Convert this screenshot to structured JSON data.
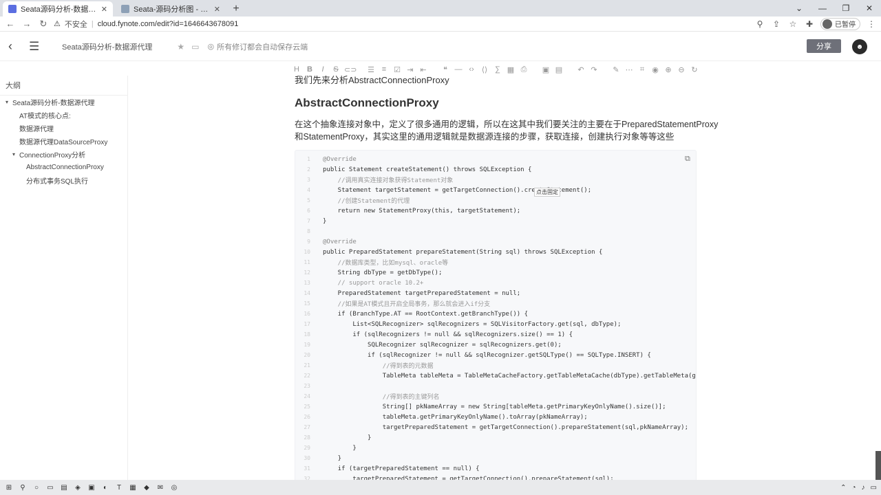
{
  "browser": {
    "tabs": [
      {
        "title": "Seata源码分析-数据源代理",
        "active": true
      },
      {
        "title": "Seata-源码分析图 - ProcessOn",
        "active": false
      }
    ],
    "address": {
      "security_label": "不安全",
      "url": "cloud.fynote.com/edit?id=1646643678091"
    },
    "profile_label": "已暂停"
  },
  "app": {
    "doc_title": "Seata源码分析-数据源代理",
    "save_status": "所有修订都会自动保存云端",
    "share_label": "分享"
  },
  "sidebar": {
    "title": "大纲",
    "items": [
      {
        "label": "Seata源码分析-数据源代理",
        "level": 0,
        "caret": "▾"
      },
      {
        "label": "AT模式的核心点:",
        "level": 1,
        "caret": ""
      },
      {
        "label": "数据源代理",
        "level": 1,
        "caret": ""
      },
      {
        "label": "数据源代理DataSourceProxy",
        "level": 1,
        "caret": ""
      },
      {
        "label": "ConnectionProxy分析",
        "level": 1,
        "caret": "▾"
      },
      {
        "label": "AbstractConnectionProxy",
        "level": 2,
        "caret": ""
      },
      {
        "label": "分布式事务SQL执行",
        "level": 2,
        "caret": ""
      }
    ]
  },
  "content": {
    "cut_text": "我们先来分析AbstractConnectionProxy",
    "heading": "AbstractConnectionProxy",
    "paragraph_lines": [
      "在这个抽象连接对象中，定义了很多通用的逻辑，所以在这其中我们要关注的主要在于PreparedStatementProxy",
      "和StatementProxy，其实这里的通用逻辑就是数据源连接的步骤，获取连接，创建执行对象等等这些"
    ],
    "tooltip": "点击固定",
    "code_lines": [
      {
        "n": "1",
        "text": "@Override"
      },
      {
        "n": "2",
        "text": "public Statement createStatement() throws SQLException {"
      },
      {
        "n": "3",
        "text": "    //调用真实连接对象获得Statement对象"
      },
      {
        "n": "4",
        "text": "    Statement targetStatement = getTargetConnection().createStatement();"
      },
      {
        "n": "5",
        "text": "    //创建Statement的代理"
      },
      {
        "n": "6",
        "text": "    return new StatementProxy(this, targetStatement);"
      },
      {
        "n": "7",
        "text": "}"
      },
      {
        "n": "8",
        "text": ""
      },
      {
        "n": "9",
        "text": "@Override"
      },
      {
        "n": "10",
        "text": "public PreparedStatement prepareStatement(String sql) throws SQLException {"
      },
      {
        "n": "11",
        "text": "    //数据库类型，比如mysql、oracle等"
      },
      {
        "n": "12",
        "text": "    String dbType = getDbType();"
      },
      {
        "n": "13",
        "text": "    // support oracle 10.2+"
      },
      {
        "n": "14",
        "text": "    PreparedStatement targetPreparedStatement = null;"
      },
      {
        "n": "15",
        "text": "    //如果是AT模式且开启全局事务，那么就会进入if分支"
      },
      {
        "n": "16",
        "text": "    if (BranchType.AT == RootContext.getBranchType()) {"
      },
      {
        "n": "17",
        "text": "        List<SQLRecognizer> sqlRecognizers = SQLVisitorFactory.get(sql, dbType);"
      },
      {
        "n": "18",
        "text": "        if (sqlRecognizers != null && sqlRecognizers.size() == 1) {"
      },
      {
        "n": "19",
        "text": "            SQLRecognizer sqlRecognizer = sqlRecognizers.get(0);"
      },
      {
        "n": "20",
        "text": "            if (sqlRecognizer != null && sqlRecognizer.getSQLType() == SQLType.INSERT) {"
      },
      {
        "n": "21",
        "text": "                //得到表的元数据"
      },
      {
        "n": "22",
        "text": "                TableMeta tableMeta = TableMetaCacheFactory.getTableMetaCache(dbType).getTableMeta(g"
      },
      {
        "n": "23",
        "text": ""
      },
      {
        "n": "24",
        "text": "                //得到表的主键列名"
      },
      {
        "n": "25",
        "text": "                String[] pkNameArray = new String[tableMeta.getPrimaryKeyOnlyName().size()];"
      },
      {
        "n": "26",
        "text": "                tableMeta.getPrimaryKeyOnlyName().toArray(pkNameArray);"
      },
      {
        "n": "27",
        "text": "                targetPreparedStatement = getTargetConnection().prepareStatement(sql,pkNameArray);"
      },
      {
        "n": "28",
        "text": "            }"
      },
      {
        "n": "29",
        "text": "        }"
      },
      {
        "n": "30",
        "text": "    }"
      },
      {
        "n": "31",
        "text": "    if (targetPreparedStatement == null) {"
      },
      {
        "n": "32",
        "text": "        targetPreparedStatement = getTargetConnection().prepareStatement(sql);"
      }
    ]
  }
}
